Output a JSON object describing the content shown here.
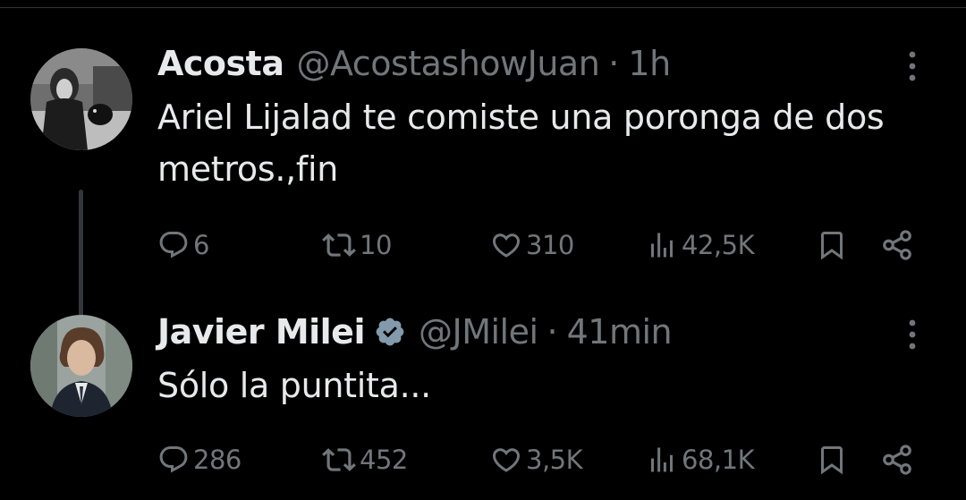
{
  "colors": {
    "background": "#000000",
    "text_primary": "#e7e9ea",
    "text_secondary": "#71767b",
    "verified_badge": "#829aab",
    "divider": "#2f3336"
  },
  "tweets": [
    {
      "display_name": "Acosta",
      "handle": "@AcostashowJuan",
      "separator": "·",
      "time": "1h",
      "verified": false,
      "text": "Ariel Lijalad te comiste una poronga de dos metros.,fin",
      "replies": "6",
      "retweets": "10",
      "likes": "310",
      "views": "42,5K",
      "icons": [
        "reply-icon",
        "retweet-icon",
        "like-icon",
        "views-icon",
        "bookmark-icon",
        "share-icon",
        "more-icon"
      ]
    },
    {
      "display_name": "Javier Milei",
      "handle": "@JMilei",
      "separator": "·",
      "time": "41min",
      "verified": true,
      "text": "Sólo la puntita...",
      "replies": "286",
      "retweets": "452",
      "likes": "3,5K",
      "views": "68,1K",
      "icons": [
        "reply-icon",
        "retweet-icon",
        "like-icon",
        "views-icon",
        "bookmark-icon",
        "share-icon",
        "more-icon"
      ]
    }
  ]
}
